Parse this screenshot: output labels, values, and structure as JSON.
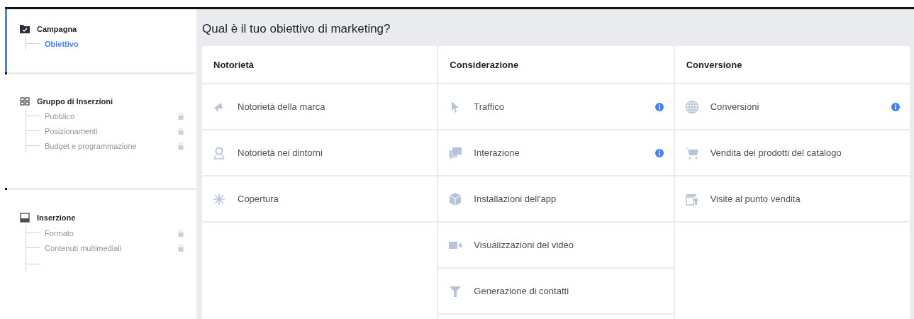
{
  "sidebar": {
    "sections": [
      {
        "kind": "campaign",
        "title": "Campagna",
        "active": true,
        "open_branch": false,
        "items": [
          {
            "label": "Obiettivo",
            "selected": true,
            "locked": false
          }
        ]
      },
      {
        "kind": "adset",
        "title": "Gruppo di Inserzioni",
        "active": false,
        "open_branch": false,
        "items": [
          {
            "label": "Pubblico",
            "selected": false,
            "locked": true
          },
          {
            "label": "Posizionamenti",
            "selected": false,
            "locked": true
          },
          {
            "label": "Budget e programmazione",
            "selected": false,
            "locked": true
          }
        ]
      },
      {
        "kind": "ad",
        "title": "Inserzione",
        "active": false,
        "open_branch": true,
        "items": [
          {
            "label": "Formato",
            "selected": false,
            "locked": true
          },
          {
            "label": "Contenuti multimediali",
            "selected": false,
            "locked": true
          }
        ]
      }
    ]
  },
  "main": {
    "title": "Qual è il tuo obiettivo di marketing?",
    "columns": [
      {
        "title": "Notorietà",
        "objectives": [
          {
            "kind": "megaphone",
            "label": "Notorietà della marca",
            "info": false
          },
          {
            "kind": "pin",
            "label": "Notorietà nei dintorni",
            "info": false
          },
          {
            "kind": "reach",
            "label": "Copertura",
            "info": false
          }
        ]
      },
      {
        "title": "Considerazione",
        "objectives": [
          {
            "kind": "cursor",
            "label": "Traffico",
            "info": true
          },
          {
            "kind": "chat",
            "label": "Interazione",
            "info": true
          },
          {
            "kind": "cube",
            "label": "Installazioni dell'app",
            "info": false
          },
          {
            "kind": "video",
            "label": "Visualizzazioni del video",
            "info": false
          },
          {
            "kind": "funnel",
            "label": "Generazione di contatti",
            "info": false
          }
        ]
      },
      {
        "title": "Conversione",
        "objectives": [
          {
            "kind": "globe",
            "label": "Conversioni",
            "info": true
          },
          {
            "kind": "cart",
            "label": "Vendita dei prodotti del catalogo",
            "info": false
          },
          {
            "kind": "store",
            "label": "Visite al punto vendita",
            "info": false
          }
        ]
      }
    ]
  }
}
